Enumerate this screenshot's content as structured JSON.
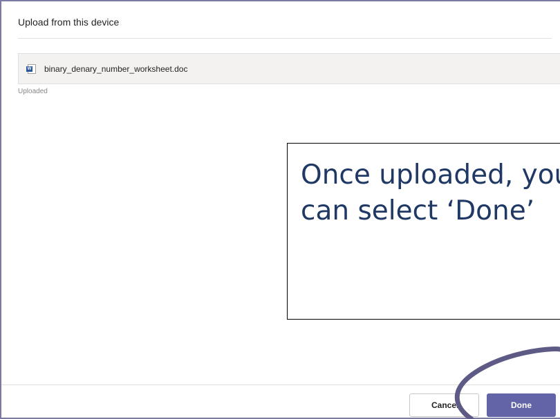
{
  "dialog": {
    "title": "Upload from this device",
    "file": {
      "icon": "word-document-icon",
      "name": "binary_denary_number_worksheet.doc"
    },
    "status": "Uploaded",
    "buttons": {
      "cancel_label": "Cancel",
      "done_label": "Done"
    }
  },
  "annotation": {
    "line1": "Once uploaded, you",
    "line2": "can select ‘Done’"
  },
  "colors": {
    "accent": "#6264a7",
    "annotation_text": "#1f3864",
    "highlight_ring": "#5d5a86"
  }
}
